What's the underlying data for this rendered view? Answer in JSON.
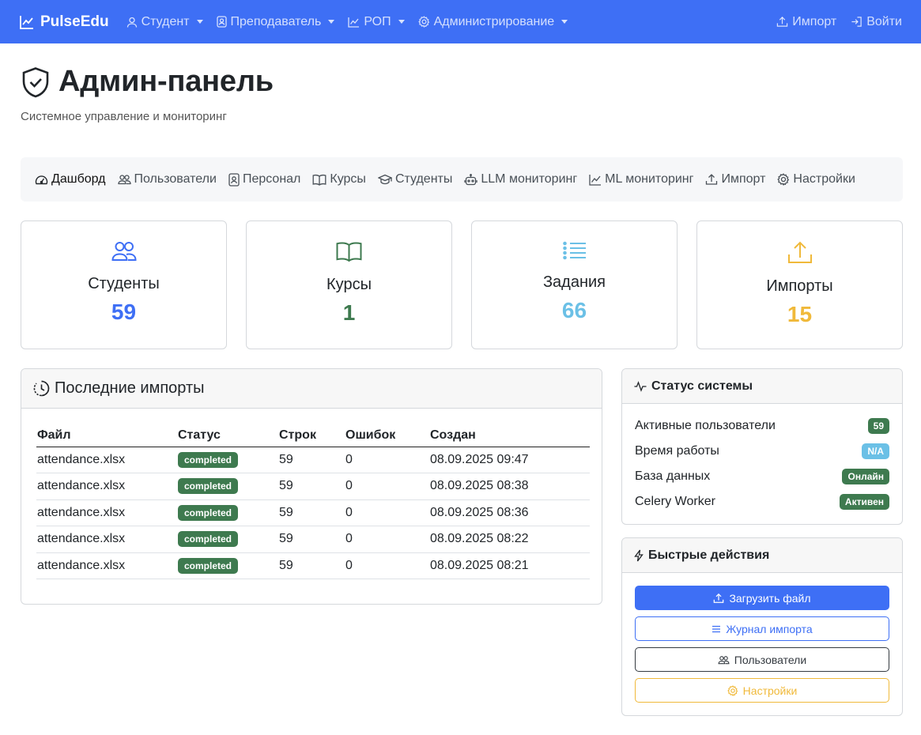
{
  "colors": {
    "primary": "#3e6ff5",
    "success": "#3e7a4f",
    "info": "#6bc0e6",
    "warning": "#f0b93a",
    "dark": "#343a40",
    "secondary": "#6c757d"
  },
  "navbar": {
    "brand": "PulseEdu",
    "menus": [
      {
        "label": "Студент",
        "icon": "person-icon"
      },
      {
        "label": "Преподаватель",
        "icon": "person-badge-icon"
      },
      {
        "label": "РОП",
        "icon": "graph-icon"
      },
      {
        "label": "Администрирование",
        "icon": "gear-icon"
      }
    ],
    "right": [
      {
        "label": "Импорт",
        "icon": "upload-icon"
      },
      {
        "label": "Войти",
        "icon": "login-icon"
      }
    ]
  },
  "header": {
    "title": "Админ-панель",
    "subtitle": "Системное управление и мониторинг"
  },
  "tabs": [
    {
      "label": "Дашборд",
      "icon": "speedometer-icon",
      "active": true
    },
    {
      "label": "Пользователи",
      "icon": "people-icon"
    },
    {
      "label": "Персонал",
      "icon": "person-badge-icon"
    },
    {
      "label": "Курсы",
      "icon": "book-icon"
    },
    {
      "label": "Студенты",
      "icon": "mortarboard-icon"
    },
    {
      "label": "LLM мониторинг",
      "icon": "robot-icon"
    },
    {
      "label": "ML мониторинг",
      "icon": "graph-icon"
    },
    {
      "label": "Импорт",
      "icon": "upload-icon"
    },
    {
      "label": "Настройки",
      "icon": "gear-icon"
    }
  ],
  "stats": [
    {
      "label": "Студенты",
      "value": "59",
      "icon": "people-icon",
      "color": "#3e6ff5"
    },
    {
      "label": "Курсы",
      "value": "1",
      "icon": "book-icon",
      "color": "#3e7a4f"
    },
    {
      "label": "Задания",
      "value": "66",
      "icon": "list-icon",
      "color": "#6bc0e6"
    },
    {
      "label": "Импорты",
      "value": "15",
      "icon": "upload-icon",
      "color": "#f0b93a"
    }
  ],
  "imports": {
    "title": "Последние импорты",
    "columns": [
      "Файл",
      "Статус",
      "Строк",
      "Ошибок",
      "Создан"
    ],
    "rows": [
      {
        "file": "attendance.xlsx",
        "status": "completed",
        "rows": "59",
        "errors": "0",
        "created": "08.09.2025 09:47"
      },
      {
        "file": "attendance.xlsx",
        "status": "completed",
        "rows": "59",
        "errors": "0",
        "created": "08.09.2025 08:38"
      },
      {
        "file": "attendance.xlsx",
        "status": "completed",
        "rows": "59",
        "errors": "0",
        "created": "08.09.2025 08:36"
      },
      {
        "file": "attendance.xlsx",
        "status": "completed",
        "rows": "59",
        "errors": "0",
        "created": "08.09.2025 08:22"
      },
      {
        "file": "attendance.xlsx",
        "status": "completed",
        "rows": "59",
        "errors": "0",
        "created": "08.09.2025 08:21"
      }
    ]
  },
  "system_status": {
    "title": "Статус системы",
    "items": [
      {
        "label": "Активные пользователи",
        "value": "59",
        "color": "#3e7a4f"
      },
      {
        "label": "Время работы",
        "value": "N/A",
        "color": "#6bc0e6"
      },
      {
        "label": "База данных",
        "value": "Онлайн",
        "color": "#3e7a4f"
      },
      {
        "label": "Celery Worker",
        "value": "Активен",
        "color": "#3e7a4f"
      }
    ]
  },
  "quick_actions": {
    "title": "Быстрые действия",
    "buttons": [
      {
        "label": "Загрузить файл",
        "icon": "upload-icon",
        "style": "primary"
      },
      {
        "label": "Журнал импорта",
        "icon": "list-icon",
        "style": "outline-primary"
      },
      {
        "label": "Пользователи",
        "icon": "people-icon",
        "style": "outline-dark"
      },
      {
        "label": "Настройки",
        "icon": "gear-icon",
        "style": "outline-warning"
      }
    ]
  }
}
